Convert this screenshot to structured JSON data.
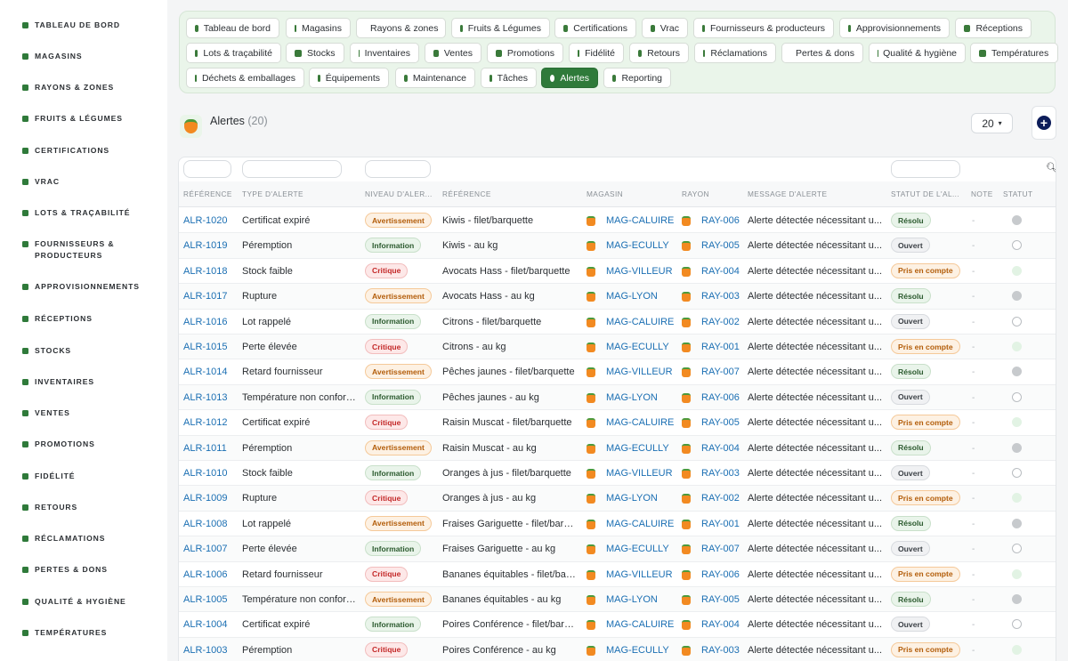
{
  "sidebar": {
    "items": [
      {
        "label": "TABLEAU DE BORD",
        "icon": "leaf-icon"
      },
      {
        "label": "MAGASINS",
        "icon": "store-icon"
      },
      {
        "label": "RAYONS & ZONES",
        "icon": "grid-icon"
      },
      {
        "label": "FRUITS & LÉGUMES",
        "icon": "leaf-icon"
      },
      {
        "label": "CERTIFICATIONS",
        "icon": "badge-icon"
      },
      {
        "label": "VRAC",
        "icon": "bulk-icon"
      },
      {
        "label": "LOTS & TRAÇABILITÉ",
        "icon": "barcode-icon"
      },
      {
        "label": "FOURNISSEURS & PRODUCTEURS",
        "icon": "tractor-icon"
      },
      {
        "label": "APPROVISIONNEMENTS",
        "icon": "supply-icon"
      },
      {
        "label": "RÉCEPTIONS",
        "icon": "truck-icon"
      },
      {
        "label": "STOCKS",
        "icon": "boxes-icon"
      },
      {
        "label": "INVENTAIRES",
        "icon": "clipboard-icon"
      },
      {
        "label": "VENTES",
        "icon": "cart-icon"
      },
      {
        "label": "PROMOTIONS",
        "icon": "tag-icon"
      },
      {
        "label": "FIDÉLITÉ",
        "icon": "award-icon"
      },
      {
        "label": "RETOURS",
        "icon": "return-icon"
      },
      {
        "label": "RÉCLAMATIONS",
        "icon": "chat-icon"
      },
      {
        "label": "PERTES & DONS",
        "icon": "trash-icon"
      },
      {
        "label": "QUALITÉ & HYGIÈNE",
        "icon": "clipboard-check-icon"
      },
      {
        "label": "TEMPÉRATURES",
        "icon": "thermometer-icon"
      }
    ]
  },
  "nav": {
    "pills": [
      {
        "label": "Tableau de bord",
        "icon": "leaf-icon"
      },
      {
        "label": "Magasins",
        "icon": "store-icon"
      },
      {
        "label": "Rayons & zones",
        "icon": "grid-icon"
      },
      {
        "label": "Fruits & Légumes",
        "icon": "leaf-icon"
      },
      {
        "label": "Certifications",
        "icon": "badge-icon"
      },
      {
        "label": "Vrac",
        "icon": "bulk-icon"
      },
      {
        "label": "Fournisseurs & producteurs",
        "icon": "tractor-icon"
      },
      {
        "label": "Approvisionnements",
        "icon": "supply-icon"
      },
      {
        "label": "Réceptions",
        "icon": "truck-icon"
      },
      {
        "label": "Lots & traçabilité",
        "icon": "barcode-icon"
      },
      {
        "label": "Stocks",
        "icon": "boxes-icon"
      },
      {
        "label": "Inventaires",
        "icon": "clipboard-icon"
      },
      {
        "label": "Ventes",
        "icon": "cart-icon"
      },
      {
        "label": "Promotions",
        "icon": "tag-icon"
      },
      {
        "label": "Fidélité",
        "icon": "award-icon"
      },
      {
        "label": "Retours",
        "icon": "return-icon"
      },
      {
        "label": "Réclamations",
        "icon": "chat-icon"
      },
      {
        "label": "Pertes & dons",
        "icon": "trash-icon"
      },
      {
        "label": "Qualité & hygiène",
        "icon": "clipboard-check-icon"
      },
      {
        "label": "Températures",
        "icon": "thermometer-icon"
      },
      {
        "label": "Déchets & emballages",
        "icon": "recycle-icon"
      },
      {
        "label": "Équipements",
        "icon": "equipment-icon"
      },
      {
        "label": "Maintenance",
        "icon": "tools-icon"
      },
      {
        "label": "Tâches",
        "icon": "list-icon"
      },
      {
        "label": "Alertes",
        "icon": "bell-icon",
        "active": true
      },
      {
        "label": "Reporting",
        "icon": "chart-pie-icon"
      }
    ]
  },
  "header": {
    "title": "Alertes",
    "count": "(20)",
    "per_page": "20",
    "add_icon": "plus-circle-icon"
  },
  "table": {
    "columns": [
      "RÉFÉRENCE",
      "TYPE D'ALERTE",
      "NIVEAU D'ALER...",
      "RÉFÉRENCE",
      "MAGASIN",
      "RAYON",
      "MESSAGE D'ALERTE",
      "STATUT DE L'AL...",
      "NOTE",
      "STATUT"
    ],
    "rows": [
      {
        "ref": "ALR-1020",
        "type": "Certificat expiré",
        "level": "Avertissement",
        "product": "Kiwis - filet/barquette",
        "store": "MAG-CALUIRE",
        "shelf": "RAY-006",
        "message": "Alerte détectée nécessitant u...",
        "status": "Résolu",
        "note": "-"
      },
      {
        "ref": "ALR-1019",
        "type": "Péremption",
        "level": "Information",
        "product": "Kiwis - au kg",
        "store": "MAG-ECULLY",
        "shelf": "RAY-005",
        "message": "Alerte détectée nécessitant u...",
        "status": "Ouvert",
        "note": "-"
      },
      {
        "ref": "ALR-1018",
        "type": "Stock faible",
        "level": "Critique",
        "product": "Avocats Hass - filet/barquette",
        "store": "MAG-VILLEUR",
        "shelf": "RAY-004",
        "message": "Alerte détectée nécessitant u...",
        "status": "Pris en compte",
        "note": "-"
      },
      {
        "ref": "ALR-1017",
        "type": "Rupture",
        "level": "Avertissement",
        "product": "Avocats Hass - au kg",
        "store": "MAG-LYON",
        "shelf": "RAY-003",
        "message": "Alerte détectée nécessitant u...",
        "status": "Résolu",
        "note": "-"
      },
      {
        "ref": "ALR-1016",
        "type": "Lot rappelé",
        "level": "Information",
        "product": "Citrons - filet/barquette",
        "store": "MAG-CALUIRE",
        "shelf": "RAY-002",
        "message": "Alerte détectée nécessitant u...",
        "status": "Ouvert",
        "note": "-"
      },
      {
        "ref": "ALR-1015",
        "type": "Perte élevée",
        "level": "Critique",
        "product": "Citrons - au kg",
        "store": "MAG-ECULLY",
        "shelf": "RAY-001",
        "message": "Alerte détectée nécessitant u...",
        "status": "Pris en compte",
        "note": "-"
      },
      {
        "ref": "ALR-1014",
        "type": "Retard fournisseur",
        "level": "Avertissement",
        "product": "Pêches jaunes - filet/barquette",
        "store": "MAG-VILLEUR",
        "shelf": "RAY-007",
        "message": "Alerte détectée nécessitant u...",
        "status": "Résolu",
        "note": "-"
      },
      {
        "ref": "ALR-1013",
        "type": "Température non conforme",
        "level": "Information",
        "product": "Pêches jaunes - au kg",
        "store": "MAG-LYON",
        "shelf": "RAY-006",
        "message": "Alerte détectée nécessitant u...",
        "status": "Ouvert",
        "note": "-"
      },
      {
        "ref": "ALR-1012",
        "type": "Certificat expiré",
        "level": "Critique",
        "product": "Raisin Muscat - filet/barquette",
        "store": "MAG-CALUIRE",
        "shelf": "RAY-005",
        "message": "Alerte détectée nécessitant u...",
        "status": "Pris en compte",
        "note": "-"
      },
      {
        "ref": "ALR-1011",
        "type": "Péremption",
        "level": "Avertissement",
        "product": "Raisin Muscat - au kg",
        "store": "MAG-ECULLY",
        "shelf": "RAY-004",
        "message": "Alerte détectée nécessitant u...",
        "status": "Résolu",
        "note": "-"
      },
      {
        "ref": "ALR-1010",
        "type": "Stock faible",
        "level": "Information",
        "product": "Oranges à jus - filet/barquette",
        "store": "MAG-VILLEUR",
        "shelf": "RAY-003",
        "message": "Alerte détectée nécessitant u...",
        "status": "Ouvert",
        "note": "-"
      },
      {
        "ref": "ALR-1009",
        "type": "Rupture",
        "level": "Critique",
        "product": "Oranges à jus - au kg",
        "store": "MAG-LYON",
        "shelf": "RAY-002",
        "message": "Alerte détectée nécessitant u...",
        "status": "Pris en compte",
        "note": "-"
      },
      {
        "ref": "ALR-1008",
        "type": "Lot rappelé",
        "level": "Avertissement",
        "product": "Fraises Gariguette - filet/barq...",
        "store": "MAG-CALUIRE",
        "shelf": "RAY-001",
        "message": "Alerte détectée nécessitant u...",
        "status": "Résolu",
        "note": "-"
      },
      {
        "ref": "ALR-1007",
        "type": "Perte élevée",
        "level": "Information",
        "product": "Fraises Gariguette - au kg",
        "store": "MAG-ECULLY",
        "shelf": "RAY-007",
        "message": "Alerte détectée nécessitant u...",
        "status": "Ouvert",
        "note": "-"
      },
      {
        "ref": "ALR-1006",
        "type": "Retard fournisseur",
        "level": "Critique",
        "product": "Bananes équitables - filet/bar...",
        "store": "MAG-VILLEUR",
        "shelf": "RAY-006",
        "message": "Alerte détectée nécessitant u...",
        "status": "Pris en compte",
        "note": "-"
      },
      {
        "ref": "ALR-1005",
        "type": "Température non conforme",
        "level": "Avertissement",
        "product": "Bananes équitables - au kg",
        "store": "MAG-LYON",
        "shelf": "RAY-005",
        "message": "Alerte détectée nécessitant u...",
        "status": "Résolu",
        "note": "-"
      },
      {
        "ref": "ALR-1004",
        "type": "Certificat expiré",
        "level": "Information",
        "product": "Poires Conférence - filet/barq...",
        "store": "MAG-CALUIRE",
        "shelf": "RAY-004",
        "message": "Alerte détectée nécessitant u...",
        "status": "Ouvert",
        "note": "-"
      },
      {
        "ref": "ALR-1003",
        "type": "Péremption",
        "level": "Critique",
        "product": "Poires Conférence - au kg",
        "store": "MAG-ECULLY",
        "shelf": "RAY-003",
        "message": "Alerte détectée nécessitant u...",
        "status": "Pris en compte",
        "note": "-"
      }
    ]
  },
  "colors": {
    "accent": "#2f7a3a",
    "link": "#1b6fb3",
    "nav_bg": "#eaf5ea"
  }
}
